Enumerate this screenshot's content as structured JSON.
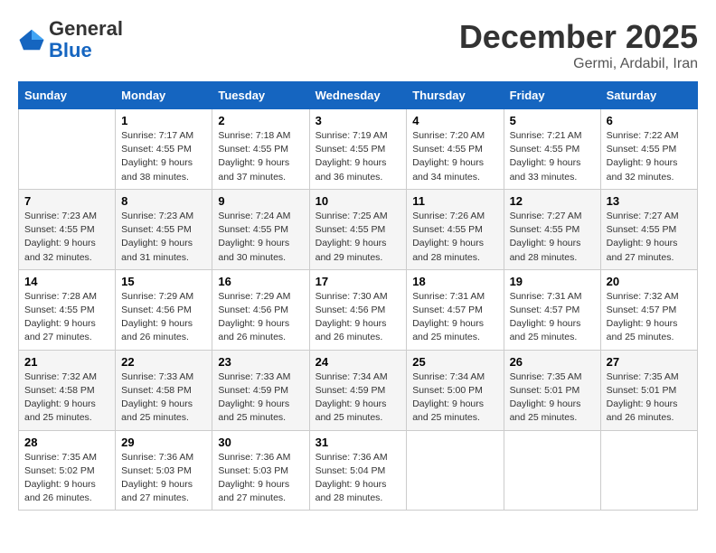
{
  "logo": {
    "general": "General",
    "blue": "Blue"
  },
  "header": {
    "month_year": "December 2025",
    "location": "Germi, Ardabil, Iran"
  },
  "weekdays": [
    "Sunday",
    "Monday",
    "Tuesday",
    "Wednesday",
    "Thursday",
    "Friday",
    "Saturday"
  ],
  "weeks": [
    [
      {
        "day": "",
        "sunrise": "",
        "sunset": "",
        "daylight": ""
      },
      {
        "day": "1",
        "sunrise": "Sunrise: 7:17 AM",
        "sunset": "Sunset: 4:55 PM",
        "daylight": "Daylight: 9 hours and 38 minutes."
      },
      {
        "day": "2",
        "sunrise": "Sunrise: 7:18 AM",
        "sunset": "Sunset: 4:55 PM",
        "daylight": "Daylight: 9 hours and 37 minutes."
      },
      {
        "day": "3",
        "sunrise": "Sunrise: 7:19 AM",
        "sunset": "Sunset: 4:55 PM",
        "daylight": "Daylight: 9 hours and 36 minutes."
      },
      {
        "day": "4",
        "sunrise": "Sunrise: 7:20 AM",
        "sunset": "Sunset: 4:55 PM",
        "daylight": "Daylight: 9 hours and 34 minutes."
      },
      {
        "day": "5",
        "sunrise": "Sunrise: 7:21 AM",
        "sunset": "Sunset: 4:55 PM",
        "daylight": "Daylight: 9 hours and 33 minutes."
      },
      {
        "day": "6",
        "sunrise": "Sunrise: 7:22 AM",
        "sunset": "Sunset: 4:55 PM",
        "daylight": "Daylight: 9 hours and 32 minutes."
      }
    ],
    [
      {
        "day": "7",
        "sunrise": "Sunrise: 7:23 AM",
        "sunset": "Sunset: 4:55 PM",
        "daylight": "Daylight: 9 hours and 32 minutes."
      },
      {
        "day": "8",
        "sunrise": "Sunrise: 7:23 AM",
        "sunset": "Sunset: 4:55 PM",
        "daylight": "Daylight: 9 hours and 31 minutes."
      },
      {
        "day": "9",
        "sunrise": "Sunrise: 7:24 AM",
        "sunset": "Sunset: 4:55 PM",
        "daylight": "Daylight: 9 hours and 30 minutes."
      },
      {
        "day": "10",
        "sunrise": "Sunrise: 7:25 AM",
        "sunset": "Sunset: 4:55 PM",
        "daylight": "Daylight: 9 hours and 29 minutes."
      },
      {
        "day": "11",
        "sunrise": "Sunrise: 7:26 AM",
        "sunset": "Sunset: 4:55 PM",
        "daylight": "Daylight: 9 hours and 28 minutes."
      },
      {
        "day": "12",
        "sunrise": "Sunrise: 7:27 AM",
        "sunset": "Sunset: 4:55 PM",
        "daylight": "Daylight: 9 hours and 28 minutes."
      },
      {
        "day": "13",
        "sunrise": "Sunrise: 7:27 AM",
        "sunset": "Sunset: 4:55 PM",
        "daylight": "Daylight: 9 hours and 27 minutes."
      }
    ],
    [
      {
        "day": "14",
        "sunrise": "Sunrise: 7:28 AM",
        "sunset": "Sunset: 4:55 PM",
        "daylight": "Daylight: 9 hours and 27 minutes."
      },
      {
        "day": "15",
        "sunrise": "Sunrise: 7:29 AM",
        "sunset": "Sunset: 4:56 PM",
        "daylight": "Daylight: 9 hours and 26 minutes."
      },
      {
        "day": "16",
        "sunrise": "Sunrise: 7:29 AM",
        "sunset": "Sunset: 4:56 PM",
        "daylight": "Daylight: 9 hours and 26 minutes."
      },
      {
        "day": "17",
        "sunrise": "Sunrise: 7:30 AM",
        "sunset": "Sunset: 4:56 PM",
        "daylight": "Daylight: 9 hours and 26 minutes."
      },
      {
        "day": "18",
        "sunrise": "Sunrise: 7:31 AM",
        "sunset": "Sunset: 4:57 PM",
        "daylight": "Daylight: 9 hours and 25 minutes."
      },
      {
        "day": "19",
        "sunrise": "Sunrise: 7:31 AM",
        "sunset": "Sunset: 4:57 PM",
        "daylight": "Daylight: 9 hours and 25 minutes."
      },
      {
        "day": "20",
        "sunrise": "Sunrise: 7:32 AM",
        "sunset": "Sunset: 4:57 PM",
        "daylight": "Daylight: 9 hours and 25 minutes."
      }
    ],
    [
      {
        "day": "21",
        "sunrise": "Sunrise: 7:32 AM",
        "sunset": "Sunset: 4:58 PM",
        "daylight": "Daylight: 9 hours and 25 minutes."
      },
      {
        "day": "22",
        "sunrise": "Sunrise: 7:33 AM",
        "sunset": "Sunset: 4:58 PM",
        "daylight": "Daylight: 9 hours and 25 minutes."
      },
      {
        "day": "23",
        "sunrise": "Sunrise: 7:33 AM",
        "sunset": "Sunset: 4:59 PM",
        "daylight": "Daylight: 9 hours and 25 minutes."
      },
      {
        "day": "24",
        "sunrise": "Sunrise: 7:34 AM",
        "sunset": "Sunset: 4:59 PM",
        "daylight": "Daylight: 9 hours and 25 minutes."
      },
      {
        "day": "25",
        "sunrise": "Sunrise: 7:34 AM",
        "sunset": "Sunset: 5:00 PM",
        "daylight": "Daylight: 9 hours and 25 minutes."
      },
      {
        "day": "26",
        "sunrise": "Sunrise: 7:35 AM",
        "sunset": "Sunset: 5:01 PM",
        "daylight": "Daylight: 9 hours and 25 minutes."
      },
      {
        "day": "27",
        "sunrise": "Sunrise: 7:35 AM",
        "sunset": "Sunset: 5:01 PM",
        "daylight": "Daylight: 9 hours and 26 minutes."
      }
    ],
    [
      {
        "day": "28",
        "sunrise": "Sunrise: 7:35 AM",
        "sunset": "Sunset: 5:02 PM",
        "daylight": "Daylight: 9 hours and 26 minutes."
      },
      {
        "day": "29",
        "sunrise": "Sunrise: 7:36 AM",
        "sunset": "Sunset: 5:03 PM",
        "daylight": "Daylight: 9 hours and 27 minutes."
      },
      {
        "day": "30",
        "sunrise": "Sunrise: 7:36 AM",
        "sunset": "Sunset: 5:03 PM",
        "daylight": "Daylight: 9 hours and 27 minutes."
      },
      {
        "day": "31",
        "sunrise": "Sunrise: 7:36 AM",
        "sunset": "Sunset: 5:04 PM",
        "daylight": "Daylight: 9 hours and 28 minutes."
      },
      {
        "day": "",
        "sunrise": "",
        "sunset": "",
        "daylight": ""
      },
      {
        "day": "",
        "sunrise": "",
        "sunset": "",
        "daylight": ""
      },
      {
        "day": "",
        "sunrise": "",
        "sunset": "",
        "daylight": ""
      }
    ]
  ]
}
